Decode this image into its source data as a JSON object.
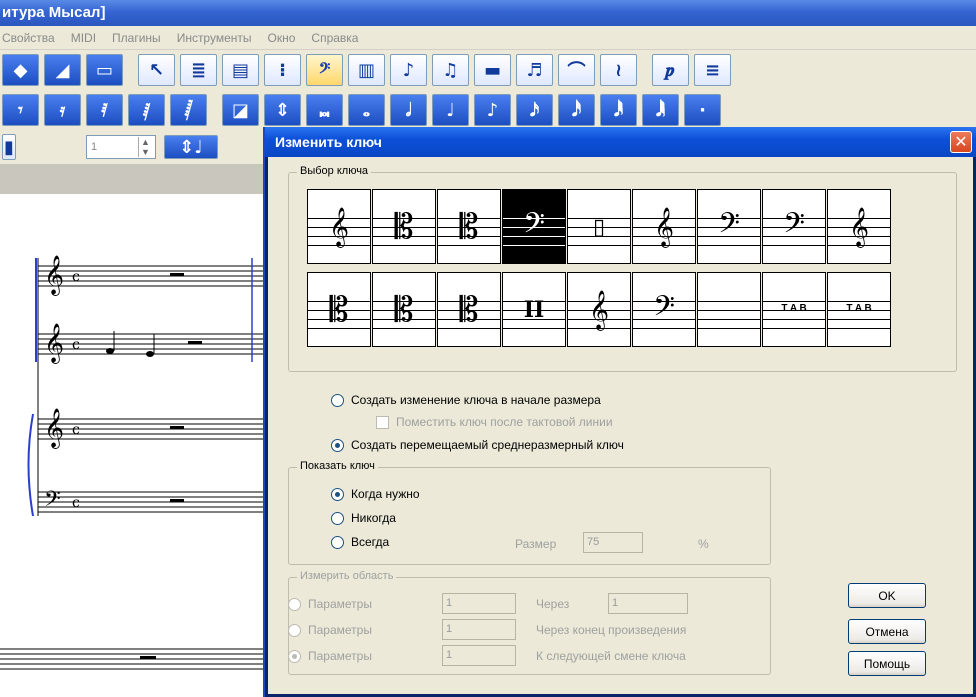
{
  "app": {
    "title": "итура Мысал]",
    "menu": [
      "Свойства",
      "MIDI",
      "Плагины",
      "Инструменты",
      "Окно",
      "Справка"
    ],
    "measure_value": "1"
  },
  "dialog": {
    "title": "Изменить ключ",
    "close_glyph": "✕",
    "clef_group_label": "Выбор ключа",
    "clefs_row1": [
      "𝄞",
      "𝄡",
      "𝄡",
      "𝄢",
      "▯",
      "𝄞",
      "𝄢",
      "𝄢",
      "𝄞"
    ],
    "clefs_row2": [
      "𝄡",
      "𝄡",
      "𝄡",
      "II",
      "𝄞",
      "𝄢",
      "",
      "T A B",
      "T A B"
    ],
    "selected_clef_index": 3,
    "option_measure_start": "Создать изменение ключа в начале размера",
    "option_after_barline": "Поместить ключ после тактовой линии",
    "option_movable": "Создать перемещаемый среднеразмерный ключ",
    "show_group_label": "Показать ключ",
    "show_when_needed": "Когда нужно",
    "show_never": "Никогда",
    "show_always": "Всегда",
    "size_label": "Размер",
    "size_value": "75",
    "size_unit": "%",
    "range_group_label": "Измерить область",
    "range_param_label": "Параметры",
    "range_param1_value": "1",
    "range_param2_value": "1",
    "range_param3_value": "1",
    "range_through_label": "Через",
    "range_through_value": "1",
    "range_to_end_label": "Через конец произведения",
    "range_to_next_label": "К следующей смене ключа",
    "ok_label": "OK",
    "cancel_label": "Отмена",
    "help_label": "Помощь"
  }
}
